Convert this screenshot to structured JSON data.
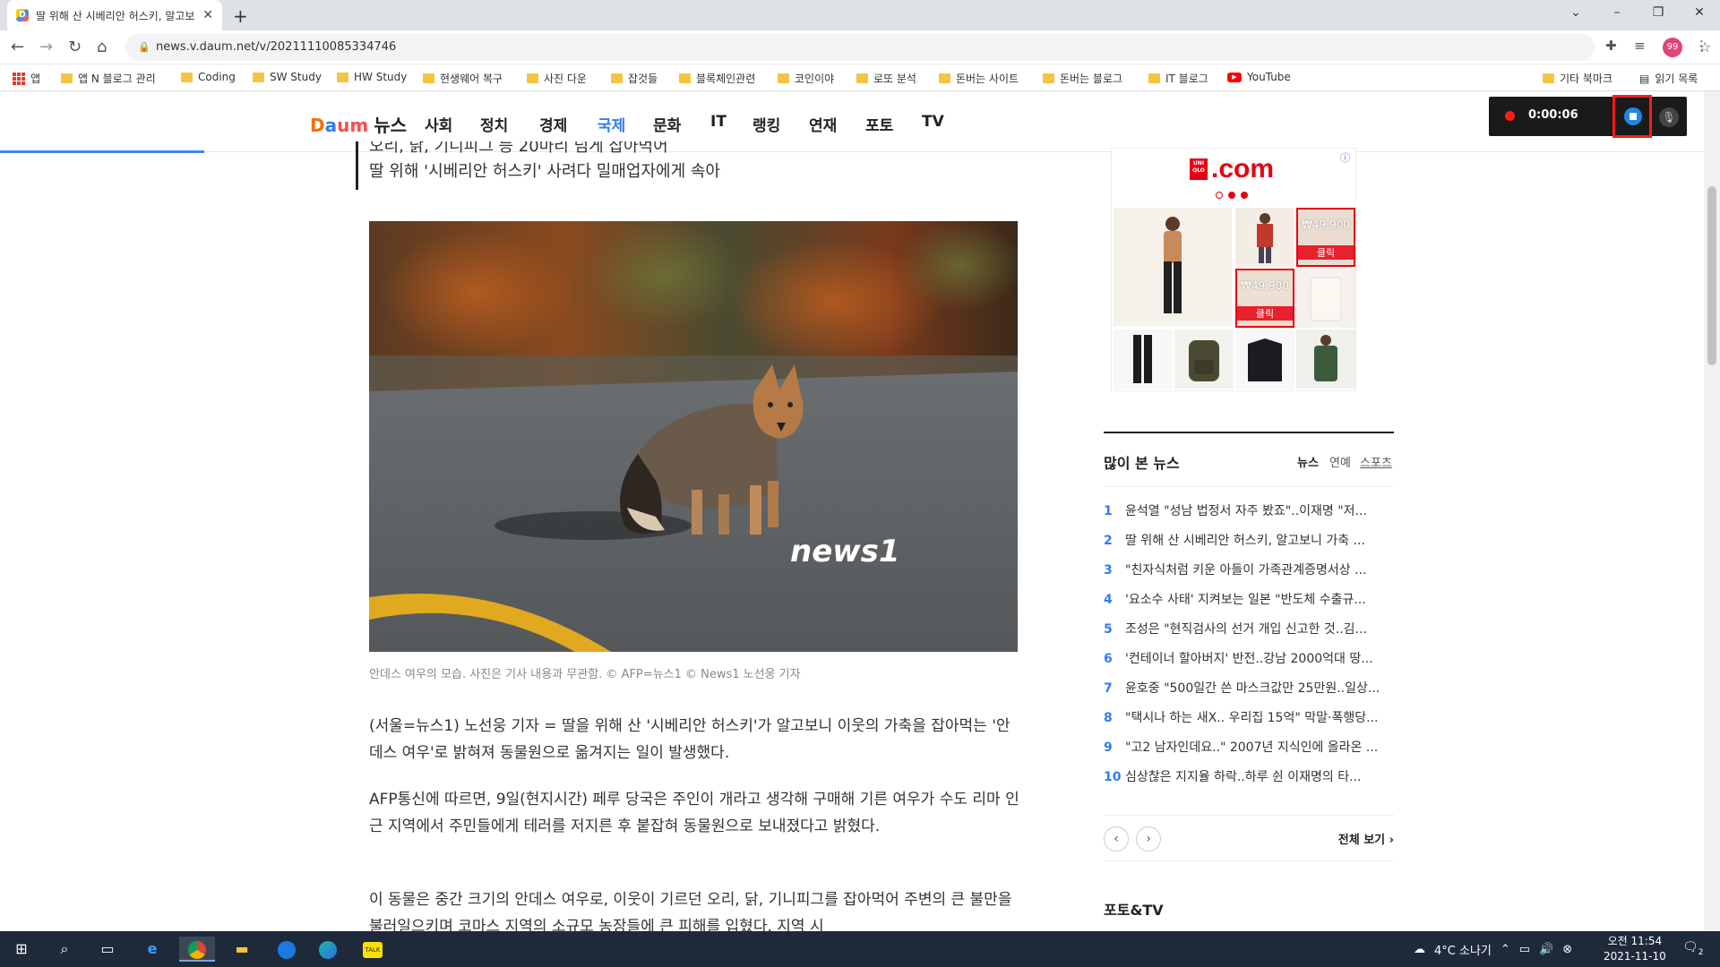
{
  "browser": {
    "tab_title": "딸 위해 산 시베리안 허스키, 알고보니 가축 잡아먹는 '안데스 여우'",
    "tab_close": "✕",
    "new_tab": "+",
    "url": "news.v.daum.net/v/20211110085334746",
    "profile_label": "99"
  },
  "bookmarks": [
    {
      "label": "앱",
      "type": "apps"
    },
    {
      "label": "앱 N 블로그 관리",
      "type": "folder"
    },
    {
      "label": "Coding",
      "type": "folder"
    },
    {
      "label": "SW Study",
      "type": "folder"
    },
    {
      "label": "HW Study",
      "type": "folder"
    },
    {
      "label": "현생웨어 복구",
      "type": "folder"
    },
    {
      "label": "사진 다운",
      "type": "folder"
    },
    {
      "label": "잡것들",
      "type": "folder"
    },
    {
      "label": "블록체인관련",
      "type": "folder"
    },
    {
      "label": "코인이야",
      "type": "folder"
    },
    {
      "label": "로또 분석",
      "type": "folder"
    },
    {
      "label": "돈버는 사이트",
      "type": "folder"
    },
    {
      "label": "돈버는 블로그",
      "type": "folder"
    },
    {
      "label": "IT 블로그",
      "type": "folder"
    },
    {
      "label": "YouTube",
      "type": "youtube"
    },
    {
      "label": "기타 북마크",
      "type": "folder"
    },
    {
      "label": "읽기 목록",
      "type": "reading"
    }
  ],
  "daum": {
    "logo_d": "D",
    "logo_a": "a",
    "logo_um": "um",
    "logo_news": "뉴스",
    "nav": [
      "사회",
      "정치",
      "경제",
      "국제",
      "문화",
      "IT",
      "랭킹",
      "연재",
      "포토",
      "TV"
    ],
    "active_nav": "국제"
  },
  "recorder": {
    "time": "0:00:06"
  },
  "article": {
    "quote_line1": "오리, 닭, 기니피그 등 20마리 넘게 잡아먹어",
    "quote_line2": "딸 위해 '시베리안 허스키' 사려다 밀매업자에게 속아",
    "photo_watermark": "news1",
    "caption": "안데스 여우의 모습. 사진은 기사 내용과 무관함. © AFP=뉴스1 © News1 노선웅 기자",
    "p1": "(서울=뉴스1) 노선웅 기자 = 딸을 위해 산 '시베리안 허스키'가 알고보니 이웃의 가축을 잡아먹는 '안데스 여우'로 밝혀져 동물원으로 옮겨지는 일이 발생했다.",
    "p2": "AFP통신에 따르면, 9일(현지시간) 페루 당국은 주인이 개라고 생각해 구매해 기른 여우가 수도 리마 인근 지역에서 주민들에게 테러를 저지른 후 붙잡혀 동물원으로 보내졌다고 밝혔다.",
    "p3": "이 동물은 중간 크기의 안데스 여우로, 이웃이 기르던 오리, 닭, 기니피그를 잡아먹어 주변의 큰 불만을 불러일으키며 코마스 지역의 소규모 농장들에 큰 피해를 입혔다. 지역 시"
  },
  "ad": {
    "brand_top": "UNI",
    "brand_bottom": "QLO",
    "domain": ".com",
    "price1": "₩49,900",
    "price2": "₩49,900",
    "click": "클릭"
  },
  "popular": {
    "title": "많이 본 뉴스",
    "tabs": [
      "뉴스",
      "연예",
      "스포츠"
    ],
    "items": [
      {
        "rank": "1",
        "title": "윤석열 \"성남 법정서 자주 봤죠\"..이재명 \"저..."
      },
      {
        "rank": "2",
        "title": "딸 위해 산 시베리안 허스키, 알고보니 가축 ..."
      },
      {
        "rank": "3",
        "title": "\"친자식처럼 키운 아들이 가족관계증명서상 ..."
      },
      {
        "rank": "4",
        "title": "'요소수 사태' 지켜보는 일본 \"반도체 수출규..."
      },
      {
        "rank": "5",
        "title": "조성은 \"현직검사의 선거 개입 신고한 것..김..."
      },
      {
        "rank": "6",
        "title": "'컨테이너 할아버지' 반전..강남 2000억대 땅..."
      },
      {
        "rank": "7",
        "title": "윤호중 \"500일간 쓴 마스크값만 25만원..일상..."
      },
      {
        "rank": "8",
        "title": "\"택시나 하는 새X.. 우리집 15억\" 막말·폭행당..."
      },
      {
        "rank": "9",
        "title": "\"고2 남자인데요..\" 2007년 지식인에 올라온 ..."
      },
      {
        "rank": "10",
        "title": "심상찮은 지지율 하락..하루 쉰 이재명의 타..."
      }
    ],
    "prev": "‹",
    "next": "›",
    "see_all": "전체 보기 ›"
  },
  "phototv": {
    "title": "포토&TV"
  },
  "taskbar": {
    "weather": "4°C 소나기",
    "time_ampm": "오전 11:54",
    "date": "2021-11-10",
    "notif_count": "2"
  }
}
